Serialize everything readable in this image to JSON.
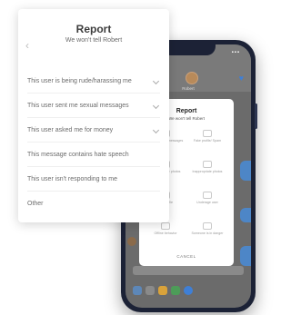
{
  "phone": {
    "header_name": "Robert",
    "sheet": {
      "title": "Report",
      "subtitle": "We won't tell Robert",
      "options": [
        {
          "label": "Inappropriate messages",
          "icon": "message-icon"
        },
        {
          "label": "Fake profile/ Spam",
          "icon": "profile-icon"
        },
        {
          "label": "Inappropriate photos",
          "icon": "camera-icon"
        },
        {
          "label": "Inappropriate photos",
          "icon": "camera-icon"
        },
        {
          "label": "Off Profile",
          "icon": "ban-icon"
        },
        {
          "label": "Underage user",
          "icon": "id-icon"
        },
        {
          "label": "Offline behavior",
          "icon": "calendar-icon"
        },
        {
          "label": "Someone is in danger",
          "icon": "alert-icon"
        }
      ],
      "cancel_label": "CANCEL"
    }
  },
  "report": {
    "title": "Report",
    "subtitle": "We won't tell Robert",
    "options": [
      {
        "label": "This user is being rude/harassing me",
        "has_chevron": true
      },
      {
        "label": "This user sent me sexual messages",
        "has_chevron": true
      },
      {
        "label": "This user asked me for money",
        "has_chevron": true
      },
      {
        "label": "This message contains hate speech",
        "has_chevron": false
      },
      {
        "label": "This user isn't responding to me",
        "has_chevron": false
      },
      {
        "label": "Other",
        "has_chevron": false
      }
    ]
  }
}
